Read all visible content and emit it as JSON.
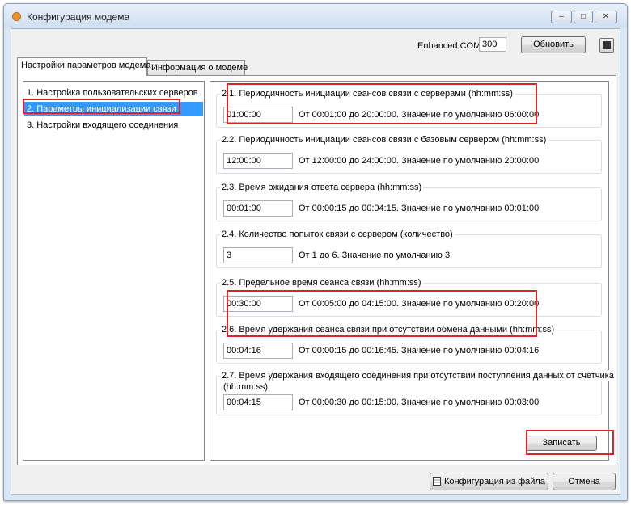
{
  "window": {
    "title": "Конфигурация модема",
    "controls": {
      "minimize": "–",
      "maximize": "□",
      "close": "✕"
    }
  },
  "header": {
    "port_label": "Enhanced COM",
    "port_value": "300",
    "refresh_label": "Обновить",
    "calc_icon": "calculator-icon"
  },
  "tabs": [
    {
      "label": "Настройки параметров модема",
      "active": true
    },
    {
      "label": "Информация о модеме",
      "active": false
    }
  ],
  "sections": [
    {
      "label": "1. Настройка пользовательских серверов",
      "selected": false
    },
    {
      "label": "2. Параметры инициализации связи",
      "selected": true
    },
    {
      "label": "3. Настройки входящего соединения",
      "selected": false
    }
  ],
  "params": [
    {
      "title": "2.1. Периодичность инициации сеансов связи с серверами (hh:mm:ss)",
      "value": "01:00:00",
      "hint": "От 00:01:00 до 20:00:00. Значение по умолчанию 06:00:00"
    },
    {
      "title": "2.2. Периодичность инициации сеансов связи с базовым сервером (hh:mm:ss)",
      "value": "12:00:00",
      "hint": "От 12:00:00 до 24:00:00. Значение по умолчанию 20:00:00"
    },
    {
      "title": "2.3. Время ожидания ответа сервера (hh:mm:ss)",
      "value": "00:01:00",
      "hint": "От 00:00:15 до 00:04:15. Значение по умолчанию 00:01:00"
    },
    {
      "title": "2.4. Количество попыток связи с сервером (количество)",
      "value": "3",
      "hint": "От 1 до 6. Значение по умолчанию 3"
    },
    {
      "title": "2.5. Предельное время сеанса связи (hh:mm:ss)",
      "value": "00:30:00",
      "hint": "От 00:05:00 до 04:15:00. Значение по умолчанию 00:20:00"
    },
    {
      "title": "2.6. Время удержания сеанса связи при отсутствии обмена данными (hh:mm:ss)",
      "value": "00:04:16",
      "hint": "От 00:00:15 до 00:16:45. Значение по умолчанию 00:04:16"
    },
    {
      "title_line1": "2.7. Время удержания входящего соединения при отсутствии поступления данных от счетчика",
      "title_line2": "(hh:mm:ss)",
      "value": "00:04:15",
      "hint": "От 00:00:30 до 00:15:00. Значение по умолчанию 00:03:00"
    }
  ],
  "actions": {
    "write_label": "Записать",
    "config_from_file_label": "Конфигурация из файла",
    "config_icon": "config-file-icon",
    "cancel_label": "Отмена"
  },
  "colors": {
    "highlight": "#e0202a",
    "selection": "#3399ff"
  }
}
